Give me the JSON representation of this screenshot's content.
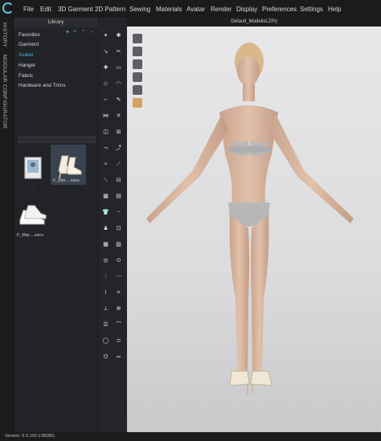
{
  "menu": [
    "File",
    "Edit",
    "3D Garment",
    "2D Pattern",
    "Sewing",
    "Materials",
    "Avatar",
    "Render",
    "Display",
    "Preferences",
    "Settings",
    "Help"
  ],
  "side_tabs": [
    "HISTORY",
    "MODULAR CONFIGURATOR"
  ],
  "library": {
    "title": "Library",
    "items": [
      "Favorites",
      "Garment",
      "Avatar",
      "Hanger",
      "Fabric",
      "Hardware and Trims"
    ],
    "active_item": "Avatar",
    "thumbnails": [
      {
        "label": "..",
        "icon": "folder-icon"
      },
      {
        "label": "F_Mar....zacs",
        "icon": "high-heel-shoe-icon"
      },
      {
        "label": "F_Mar....zacs",
        "icon": "sneaker-icon"
      }
    ]
  },
  "viewport": {
    "title": "Default_Modelist.ZPrj"
  },
  "status": {
    "text": "Version: 5.0.100 (r38285)"
  },
  "colors": {
    "accent": "#4ab0e0",
    "bg": "#1e1f21",
    "panel": "#222326"
  }
}
